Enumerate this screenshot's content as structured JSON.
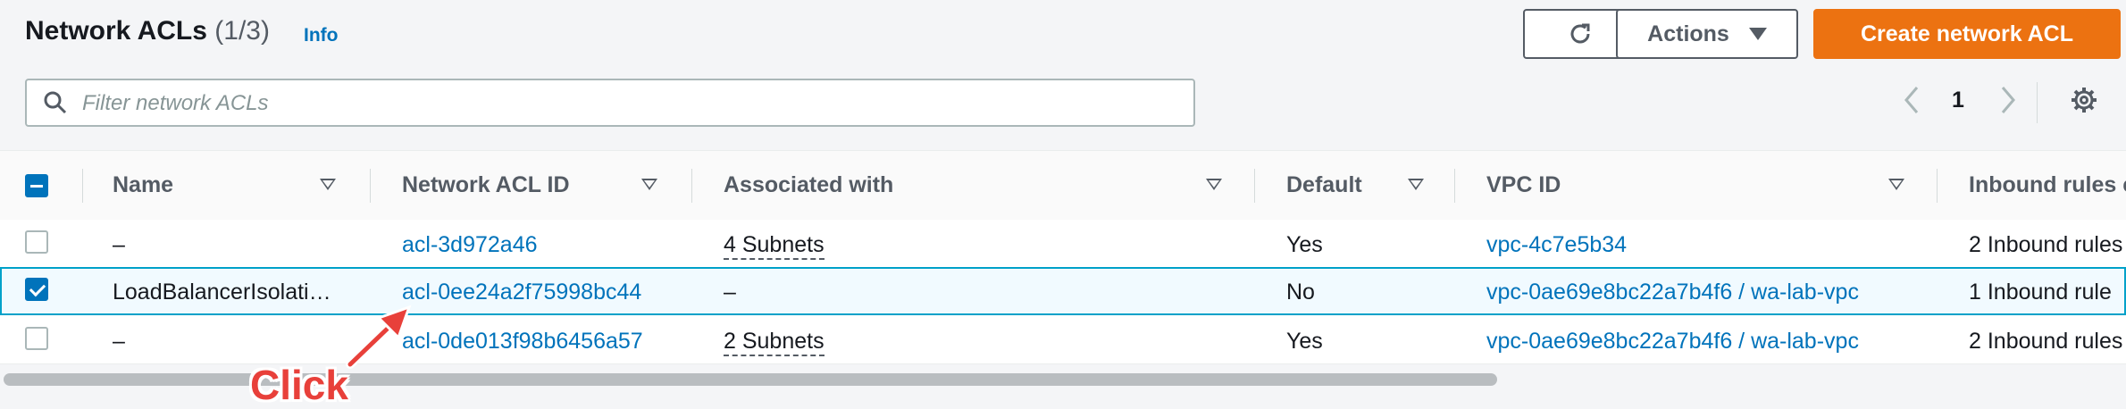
{
  "header": {
    "title": "Network ACLs",
    "count": "(1/3)",
    "info_label": "Info",
    "actions_label": "Actions",
    "create_label": "Create network ACL"
  },
  "search": {
    "placeholder": "Filter network ACLs"
  },
  "pagination": {
    "page": "1"
  },
  "table": {
    "columns": [
      "Name",
      "Network ACL ID",
      "Associated with",
      "Default",
      "VPC ID",
      "Inbound rules c"
    ],
    "rows": [
      {
        "selected": false,
        "name": "–",
        "acl_id": "acl-3d972a46",
        "associated": "4 Subnets",
        "default": "Yes",
        "vpc": "vpc-4c7e5b34",
        "inbound": "2 Inbound rules"
      },
      {
        "selected": true,
        "name": "LoadBalancerIsolati…",
        "acl_id": "acl-0ee24a2f75998bc44",
        "associated": "–",
        "default": "No",
        "vpc": "vpc-0ae69e8bc22a7b4f6 / wa-lab-vpc",
        "inbound": "1 Inbound rule"
      },
      {
        "selected": false,
        "name": "–",
        "acl_id": "acl-0de013f98b6456a57",
        "associated": "2 Subnets",
        "default": "Yes",
        "vpc": "vpc-0ae69e8bc22a7b4f6 / wa-lab-vpc",
        "inbound": "2 Inbound rules"
      }
    ]
  },
  "annotation": {
    "label": "Click",
    "color": "#e8403a"
  },
  "colors": {
    "accent": "#0073bb",
    "primary_button": "#ec7211",
    "selected_row_border": "#00a1c9"
  },
  "icons": {
    "refresh": "refresh-icon",
    "search": "search-icon",
    "settings": "gear-icon",
    "prev": "chevron-left-icon",
    "next": "chevron-right-icon"
  }
}
